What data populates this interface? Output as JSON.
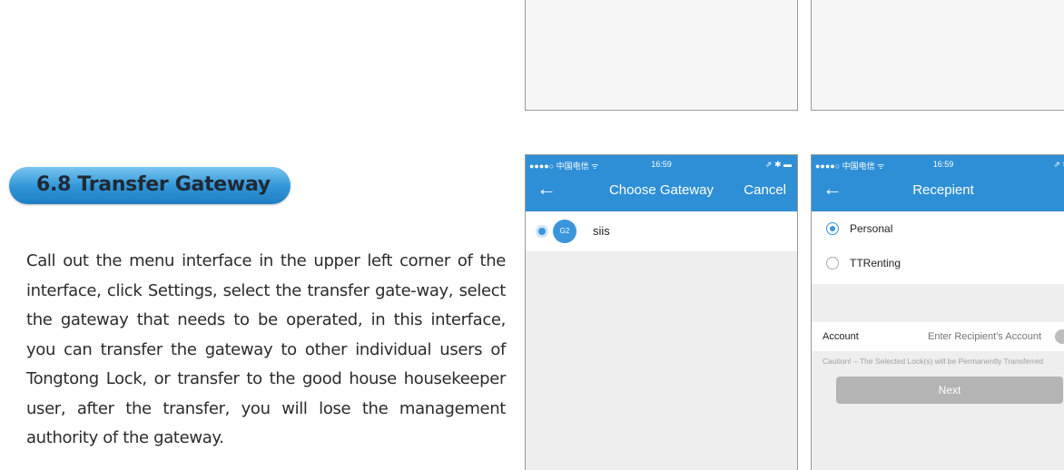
{
  "section": {
    "title": "6.8 Transfer Gateway",
    "body": "Call out the menu interface in the upper left corner of the interface, click Settings, select the transfer gate-way, select the gateway that needs to be operated, in this interface, you can transfer the gateway to other individual users of Tongtong Lock, or transfer to the good house housekeeper user, after the transfer, you will lose the management authority of the gateway."
  },
  "screen1": {
    "status": {
      "carrier": "●●●●○ 中国电信 ᯤ",
      "time": "16:59",
      "battery": "⇗ ✱ ▬"
    },
    "nav": {
      "back": "←",
      "title": "Choose Gateway",
      "cancel": "Cancel"
    },
    "gateway": {
      "icon_text": "G2",
      "name": "siis",
      "selected": true
    }
  },
  "screen2": {
    "status": {
      "carrier": "●●●●○ 中国电信 ᯤ",
      "time": "16:59",
      "battery": "⇗ ✱"
    },
    "nav": {
      "back": "←",
      "title": "Recepient"
    },
    "options": [
      {
        "label": "Personal",
        "selected": true
      },
      {
        "label": "TTRenting",
        "selected": false
      }
    ],
    "account": {
      "label": "Account",
      "placeholder": "Enter Recipient's Account"
    },
    "caution": "Caution! – The Selected Lock(s) will be Permanently Transferred",
    "next": "Next"
  },
  "colors": {
    "accent": "#2e8fd6",
    "pill": "#2f94d6",
    "button_disabled": "#b4b4b4"
  },
  "icons": [
    "back-arrow-icon",
    "radio-icon",
    "gateway-icon",
    "contact-icon"
  ]
}
